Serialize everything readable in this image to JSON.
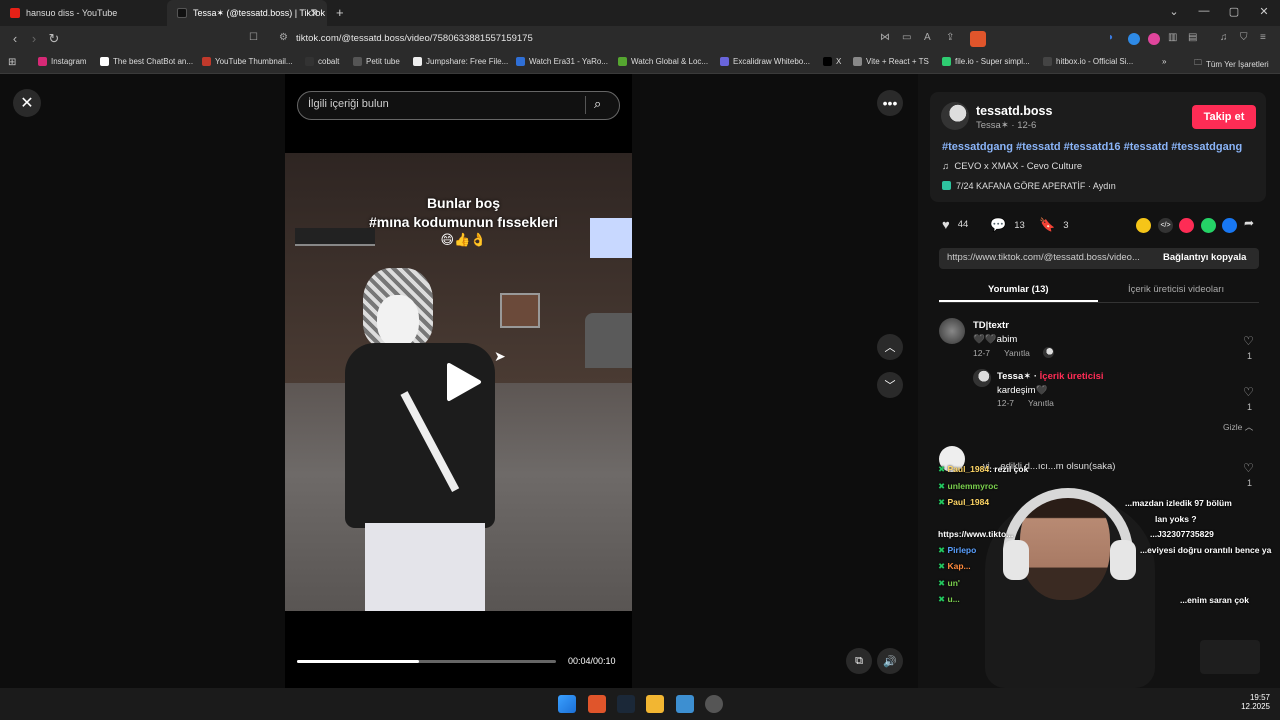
{
  "browser": {
    "tabs": [
      {
        "title": "hansuo diss - YouTube",
        "active": false
      },
      {
        "title": "Tessa✶ (@tessatd.boss) | TikTok",
        "active": true
      }
    ],
    "new_tab": "+",
    "url": "tiktok.com/@tessatd.boss/video/7580633881557159175",
    "bookmarks": [
      {
        "label": "Instagram",
        "color": "#d62976"
      },
      {
        "label": "The best ChatBot an...",
        "color": "#ffffff"
      },
      {
        "label": "YouTube Thumbnail...",
        "color": "#c0392b"
      },
      {
        "label": "cobalt",
        "color": "#333333"
      },
      {
        "label": "Petit tube",
        "color": "#555555"
      },
      {
        "label": "Jumpshare: Free File...",
        "color": "#eeeeee"
      },
      {
        "label": "Watch Era31 - YaRo...",
        "color": "#2f6fd6"
      },
      {
        "label": "Watch Global & Loc...",
        "color": "#55a630"
      },
      {
        "label": "Excalidraw Whitebo...",
        "color": "#6965db"
      },
      {
        "label": "X",
        "color": "#000000"
      },
      {
        "label": "Vite + React + TS",
        "color": "#888888"
      },
      {
        "label": "file.io - Super simpl...",
        "color": "#2ecc71"
      },
      {
        "label": "hitbox.io - Official Si...",
        "color": "#444444"
      }
    ],
    "bookmarks_more": "»",
    "all_bookmarks": "Tüm Yer İşaretleri"
  },
  "search": {
    "placeholder": "İlgili içeriği bulun"
  },
  "video": {
    "caption_line1": "Bunlar boş",
    "caption_line2": "#mına kodumunun fıssekleri",
    "caption_emojis": "😄👍👌",
    "time": "00:04/00:10",
    "progress": 0.47
  },
  "author": {
    "username": "tessatd.boss",
    "display": "Tessa✶ · 12-6",
    "follow_label": "Takip et",
    "hashtags": "#tessatdgang #tessatd #tessatd16 #tessatd #tessatdgang",
    "music": "CEVO x XMAX - Cevo Culture",
    "location": "7/24 KAFANA GÖRE APERATİF · Aydın"
  },
  "stats": {
    "likes": "44",
    "comments": "13",
    "saves": "3"
  },
  "link": {
    "url": "https://www.tiktok.com/@tessatd.boss/video...",
    "copy_label": "Bağlantıyı kopyala"
  },
  "tabs": {
    "comments": "Yorumlar (13)",
    "creator_videos": "İçerik üreticisi videoları"
  },
  "comments": [
    {
      "name": "TD|textr",
      "text": "🖤🖤abim",
      "date": "12-7",
      "reply": "Yanıtla",
      "likes": "1"
    },
    {
      "name": "Tessa✶ · ",
      "badge": "İçerik üreticisi",
      "text": "kardeşim🖤",
      "date": "12-7",
      "reply": "Yanıtla",
      "likes": "1"
    },
    {
      "hide": "Gizle",
      "text": "...vi ...edikli d...ıcı...m olsun(saka)",
      "likes": "1"
    }
  ],
  "chat_overlay": [
    {
      "name": "Paul_1984",
      "text": "rezil çok",
      "color": "#ffd666"
    },
    {
      "name": "unlemmyroc",
      "text": "",
      "color": "#7bd14e"
    },
    {
      "name": "Paul_1984",
      "text": "",
      "color": "#ffd666"
    },
    {
      "name": "",
      "text": "https://www.tikto...",
      "color": "#ffffff"
    },
    {
      "name": "Pirlepo",
      "text": "Bi...",
      "color": "#5aa0ff"
    },
    {
      "name": "Kap...",
      "text": "",
      "color": "#ff8a3d"
    },
    {
      "name": "un'",
      "text": "",
      "color": "#7bd14e"
    },
    {
      "name": "u...",
      "text": "",
      "color": "#7bd14e"
    }
  ],
  "chat_right": [
    "...mazdan izledik 97 bölüm",
    "lan yoks ?",
    "...J32307735829",
    "...eviyesi doğru orantılı bence ya",
    "...enim saran çok"
  ],
  "clock": {
    "time": "19:57",
    "date": "12.2025"
  }
}
